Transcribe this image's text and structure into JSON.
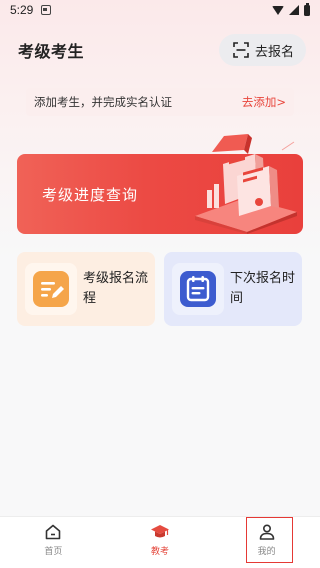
{
  "status_bar": {
    "time": "5:29",
    "icons": [
      "notification-icon",
      "wifi-icon",
      "signal-icon",
      "battery-icon"
    ]
  },
  "header": {
    "title": "考级考生",
    "register_button": {
      "label": "去报名",
      "icon": "scan-icon"
    }
  },
  "notice": {
    "text": "添加考生，并完成实名认证",
    "link_label": "去添加>"
  },
  "banner": {
    "title": "考级进度查询"
  },
  "cards": [
    {
      "label": "考级报名流程",
      "icon": "edit-document-icon",
      "color": "#f5a54a"
    },
    {
      "label": "下次报名时间",
      "icon": "calendar-icon",
      "color": "#3d5ccf"
    }
  ],
  "tab_bar": {
    "tabs": [
      {
        "label": "首页",
        "icon": "home-icon",
        "active": false
      },
      {
        "label": "教考",
        "icon": "graduation-cap-icon",
        "active": true
      },
      {
        "label": "我的",
        "icon": "user-icon",
        "active": false
      }
    ]
  },
  "colors": {
    "accent": "#e8463c",
    "banner_start": "#f06257",
    "banner_end": "#e9403c",
    "highlight_border": "#e53935"
  }
}
